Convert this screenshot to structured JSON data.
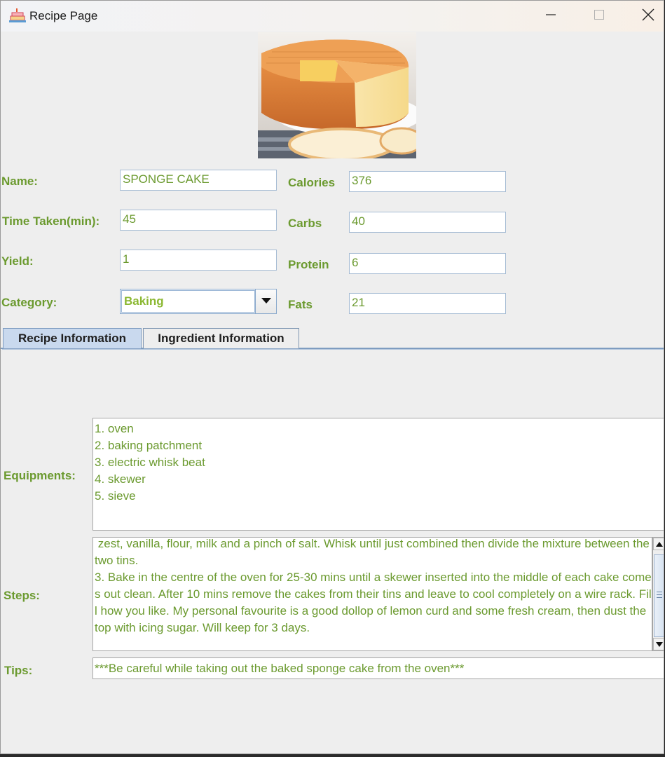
{
  "window": {
    "title": "Recipe Page",
    "app_icon": "cake-icon"
  },
  "window_controls": {
    "minimize": "minimize-icon",
    "maximize": "maximize-icon",
    "close": "close-icon"
  },
  "image": {
    "subject": "sponge-cake-photo"
  },
  "form": {
    "name": {
      "label": "Name:",
      "value": "SPONGE CAKE"
    },
    "time": {
      "label": "Time Taken(min):",
      "value": "45"
    },
    "yield": {
      "label": "Yield:",
      "value": "1"
    },
    "category": {
      "label": "Category:",
      "value": "Baking"
    },
    "calories": {
      "label": "Calories",
      "value": "376"
    },
    "carbs": {
      "label": "Carbs",
      "value": "40"
    },
    "protein": {
      "label": "Protein",
      "value": "6"
    },
    "fats": {
      "label": "Fats",
      "value": "21"
    }
  },
  "tabs": [
    {
      "label": "Recipe Information",
      "active": true
    },
    {
      "label": "Ingredient Information",
      "active": false
    }
  ],
  "recipe": {
    "equipments_label": "Equipments:",
    "equipments": [
      "1. oven",
      "2. baking patchment",
      "3. electric whisk beat",
      "4. skewer",
      "5. sieve"
    ],
    "steps_label": "Steps:",
    "steps_visible": [
      " zest, vanilla, flour, milk and a pinch of salt. Whisk until just combined then divide the mixture between the two tins.",
      "",
      "3. Bake in the centre of the oven for 25-30 mins until a skewer inserted into the middle of each cake comes out clean. After 10 mins remove the cakes from their tins and leave to cool completely on a wire rack. Fill how you like. My personal favourite is a good dollop of lemon curd and some fresh cream, then dust the top with icing sugar. Will keep for 3 days."
    ],
    "tips_label": "Tips:",
    "tips": "***Be careful while taking out the baked sponge cake from the oven***"
  },
  "colors": {
    "label_green": "#6b9a2f",
    "combo_green": "#8bb832",
    "tab_active": "#c9d9ee",
    "window_bg": "#eeeeee"
  }
}
